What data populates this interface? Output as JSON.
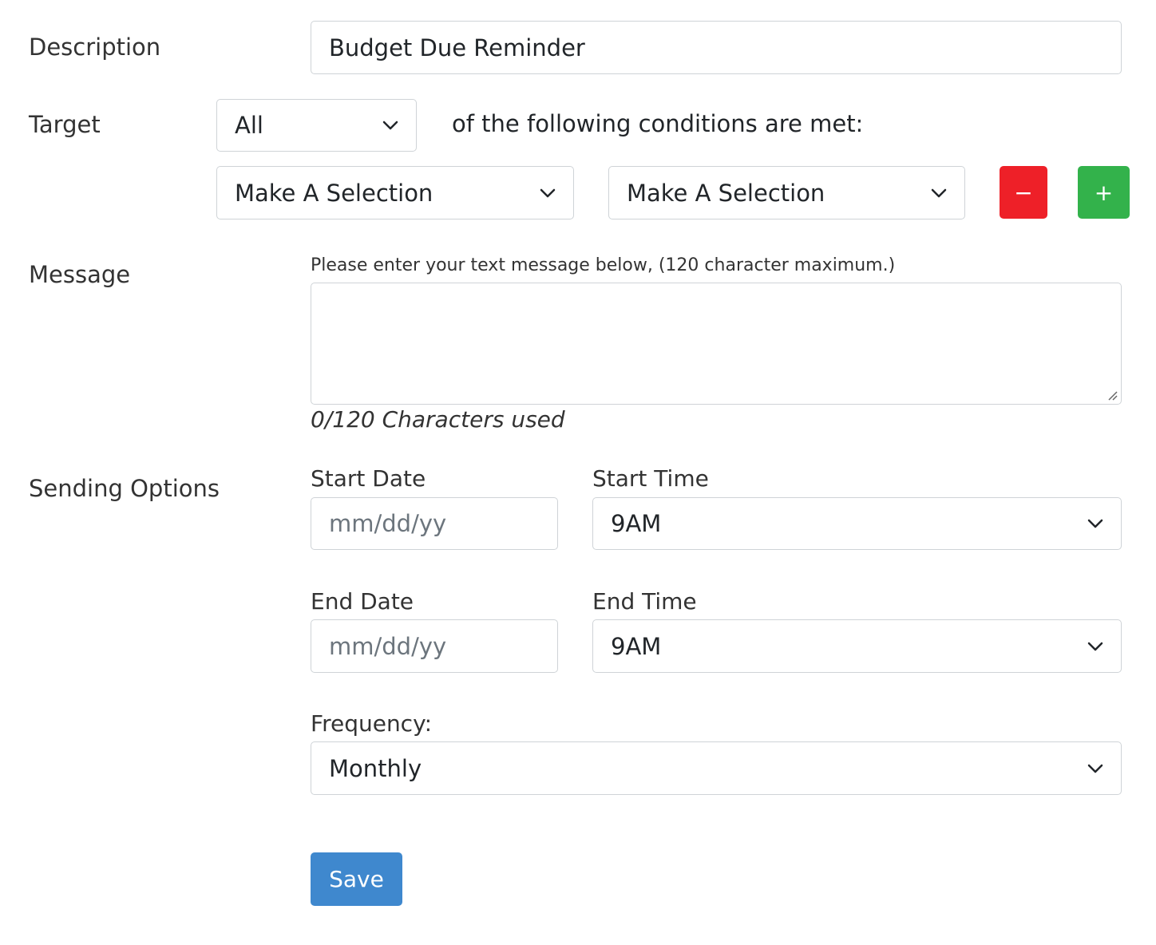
{
  "description": {
    "label": "Description",
    "value": "Budget Due Reminder"
  },
  "target": {
    "label": "Target",
    "match_select": "All",
    "condition_text": "of the following conditions are met:",
    "condition_field_select": "Make A Selection",
    "condition_operator_select": "Make A Selection",
    "remove_label": "−",
    "add_label": "+"
  },
  "message": {
    "label": "Message",
    "hint": "Please enter your text message below, (120 character maximum.)",
    "value": "",
    "counter": "0/120 Characters used"
  },
  "sending": {
    "label": "Sending Options",
    "start_date_label": "Start Date",
    "start_date_placeholder": "mm/dd/yy",
    "start_time_label": "Start Time",
    "start_time_value": "9AM",
    "end_date_label": "End Date",
    "end_date_placeholder": "mm/dd/yy",
    "end_time_label": "End Time",
    "end_time_value": "9AM",
    "frequency_label": "Frequency:",
    "frequency_value": "Monthly"
  },
  "save_label": "Save",
  "colors": {
    "remove": "#ee2028",
    "add": "#33b24b",
    "save": "#3f88ce",
    "border": "#cfd3d7"
  },
  "icons": {
    "select_arrow": "chevron-down-icon",
    "textarea_grip": "resize-grip-icon"
  }
}
